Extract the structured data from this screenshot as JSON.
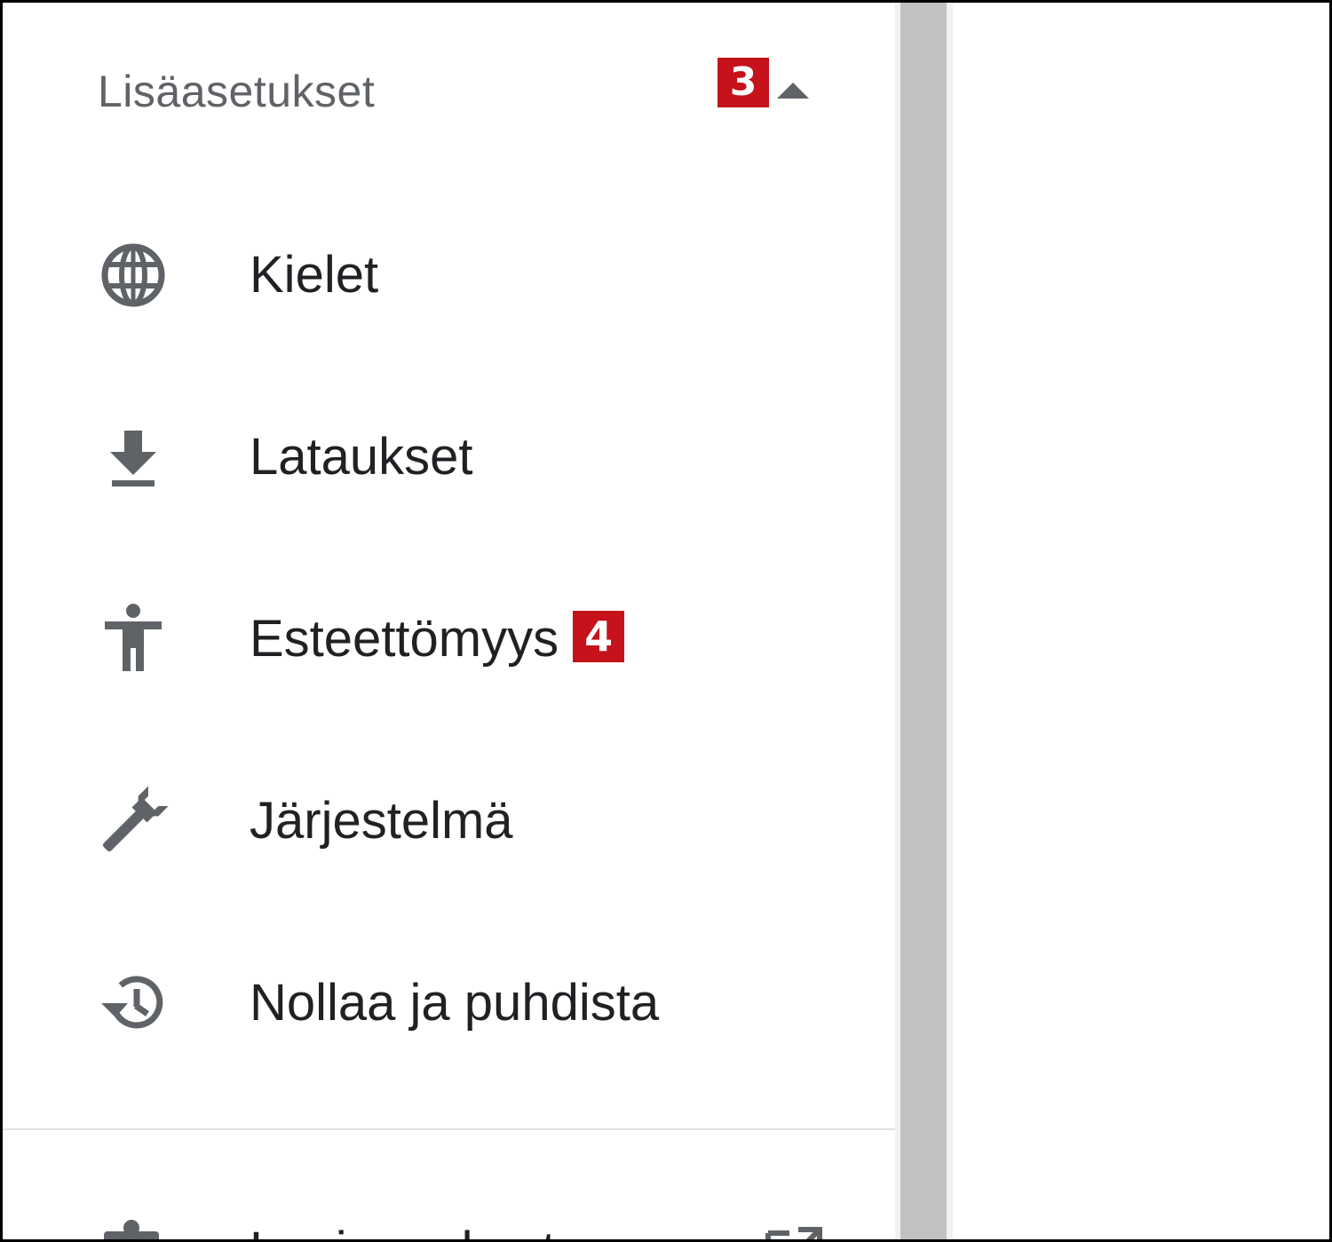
{
  "section": {
    "title": "Lisäasetukset",
    "badge": "3",
    "expanded": true
  },
  "menu": {
    "items": [
      {
        "label": "Kielet",
        "icon": "globe-icon"
      },
      {
        "label": "Lataukset",
        "icon": "download-icon"
      },
      {
        "label": "Esteettömyys",
        "icon": "accessibility-icon",
        "badge": "4"
      },
      {
        "label": "Järjestelmä",
        "icon": "wrench-icon"
      },
      {
        "label": "Nollaa ja puhdista",
        "icon": "restore-history-icon"
      }
    ]
  },
  "partial_item": {
    "label": "Laajennukset",
    "icon": "extension-icon",
    "trailing_icon": "open-in-new-icon"
  },
  "colors": {
    "badge": "#c5121b",
    "icon": "#5f6368",
    "label": "#202124",
    "section_title": "#5f6368",
    "scrollbar_thumb": "#c1c1c1"
  }
}
